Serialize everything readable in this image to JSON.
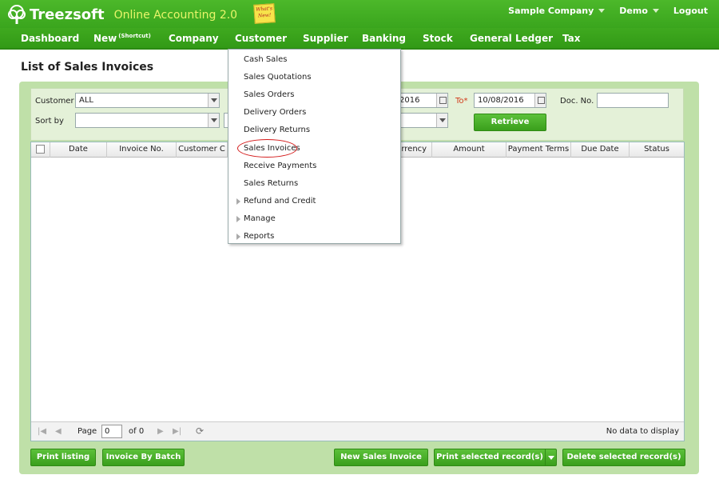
{
  "header": {
    "brand": "Treezsoft",
    "product": "Online Accounting 2.0",
    "sticky_note": "What's New!",
    "company_menu": "Sample Company",
    "user_menu": "Demo",
    "logout": "Logout"
  },
  "nav": {
    "dashboard": "Dashboard",
    "new": "New",
    "new_sup": "(Shortcut)",
    "company": "Company",
    "customer": "Customer",
    "supplier": "Supplier",
    "banking": "Banking",
    "stock": "Stock",
    "general_ledger": "General Ledger",
    "tax": "Tax"
  },
  "page_title": "List of Sales Invoices",
  "filters": {
    "customer_label": "Customer",
    "customer_value": "ALL",
    "sort_label": "Sort by",
    "sort_value": "",
    "from_date_partial": "2016",
    "to_label": "To*",
    "to_date": "10/08/2016",
    "doc_no_label": "Doc. No.",
    "doc_no_value": "",
    "retrieve": "Retrieve"
  },
  "grid": {
    "columns": [
      "Date",
      "Invoice No.",
      "Customer C",
      "urrency",
      "Amount",
      "Payment Terms",
      "Due Date",
      "Status"
    ],
    "rows": []
  },
  "pager": {
    "page_label": "Page",
    "page_value": "0",
    "of_label": "of 0",
    "status": "No data to display"
  },
  "buttons": {
    "print_listing": "Print listing",
    "invoice_by_batch": "Invoice By Batch",
    "new_sales_invoice": "New Sales Invoice",
    "print_selected": "Print selected record(s)",
    "delete_selected": "Delete selected record(s)"
  },
  "customer_menu": {
    "items": [
      {
        "label": "Cash Sales",
        "submenu": false
      },
      {
        "label": "Sales Quotations",
        "submenu": false
      },
      {
        "label": "Sales Orders",
        "submenu": false
      },
      {
        "label": "Delivery Orders",
        "submenu": false
      },
      {
        "label": "Delivery Returns",
        "submenu": false
      },
      {
        "label": "Sales Invoices",
        "submenu": false,
        "highlighted": true
      },
      {
        "label": "Receive Payments",
        "submenu": false
      },
      {
        "label": "Sales Returns",
        "submenu": false
      },
      {
        "label": "Refund and Credit",
        "submenu": true
      },
      {
        "label": "Manage",
        "submenu": true
      },
      {
        "label": "Reports",
        "submenu": true
      }
    ]
  },
  "colors": {
    "header_green": "#3aa51d",
    "panel_green": "#bfe0a8",
    "button_green": "#4cb22b",
    "highlight_circle": "#d41b1b",
    "product_text": "#e8f56a"
  }
}
